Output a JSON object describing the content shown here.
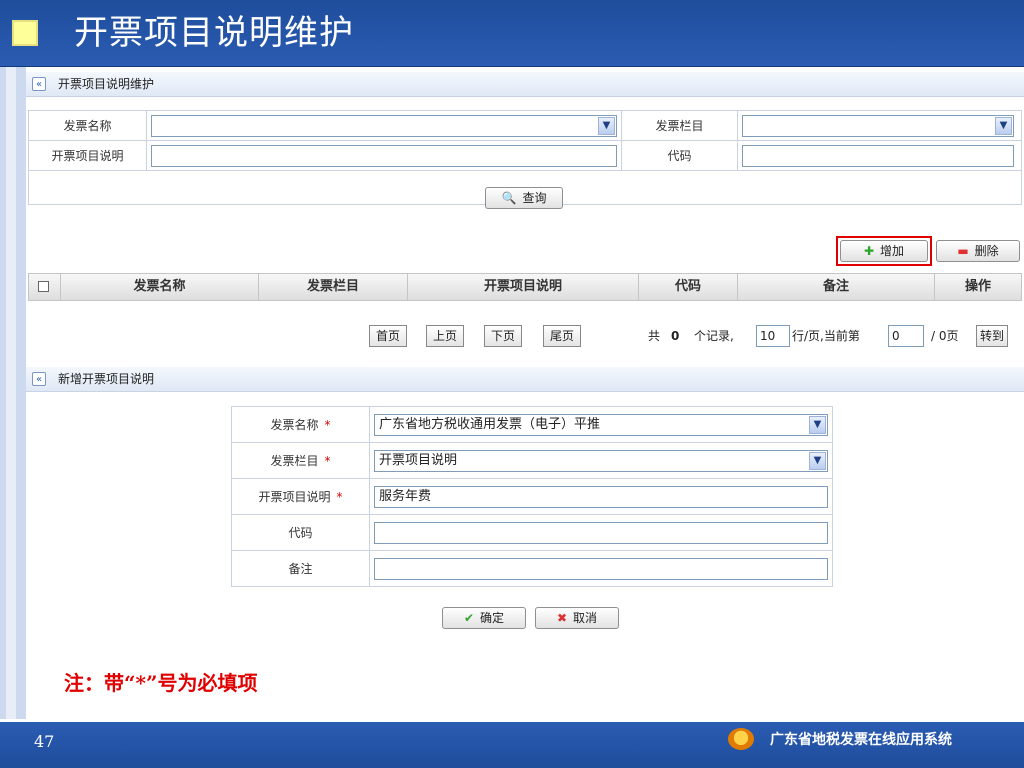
{
  "slide": {
    "title": "开票项目说明维护",
    "page_number": "47",
    "brand": "广东省地税发票在线应用系统"
  },
  "search_panel": {
    "title": "开票项目说明维护",
    "invoice_name_label": "发票名称",
    "invoice_name_value": "",
    "invoice_column_label": "发票栏目",
    "invoice_column_value": "",
    "item_desc_label": "开票项目说明",
    "item_desc_value": "",
    "code_label": "代码",
    "code_value": "",
    "query_button": "查询"
  },
  "toolbar": {
    "add_label": "增加",
    "delete_label": "删除"
  },
  "grid": {
    "columns": [
      "发票名称",
      "发票栏目",
      "开票项目说明",
      "代码",
      "备注",
      "操作"
    ],
    "rows": []
  },
  "pager": {
    "first": "首页",
    "prev": "上页",
    "next": "下页",
    "last": "尾页",
    "total_prefix": "共",
    "total_count": "0",
    "total_suffix": "个记录,",
    "rows_per_page": "10",
    "rows_per_page_suffix": "行/页,当前第",
    "current_page": "0",
    "page_total": "/ 0页",
    "goto": "转到"
  },
  "add_panel": {
    "title": "新增开票项目说明",
    "invoice_name_label": "发票名称",
    "invoice_name_value": "广东省地方税收通用发票（电子）平推",
    "invoice_column_label": "发票栏目",
    "invoice_column_value": "开票项目说明",
    "item_desc_label": "开票项目说明",
    "item_desc_value": "服务年费",
    "code_label": "代码",
    "code_value": "",
    "remark_label": "备注",
    "remark_value": "",
    "required_mark": "*",
    "confirm_button": "确定",
    "cancel_button": "取消"
  },
  "note": "注：带“*”号为必填项",
  "colors": {
    "header_blue": "#1f4d9c",
    "note_red": "#e00000",
    "highlight_red": "#e00000"
  }
}
